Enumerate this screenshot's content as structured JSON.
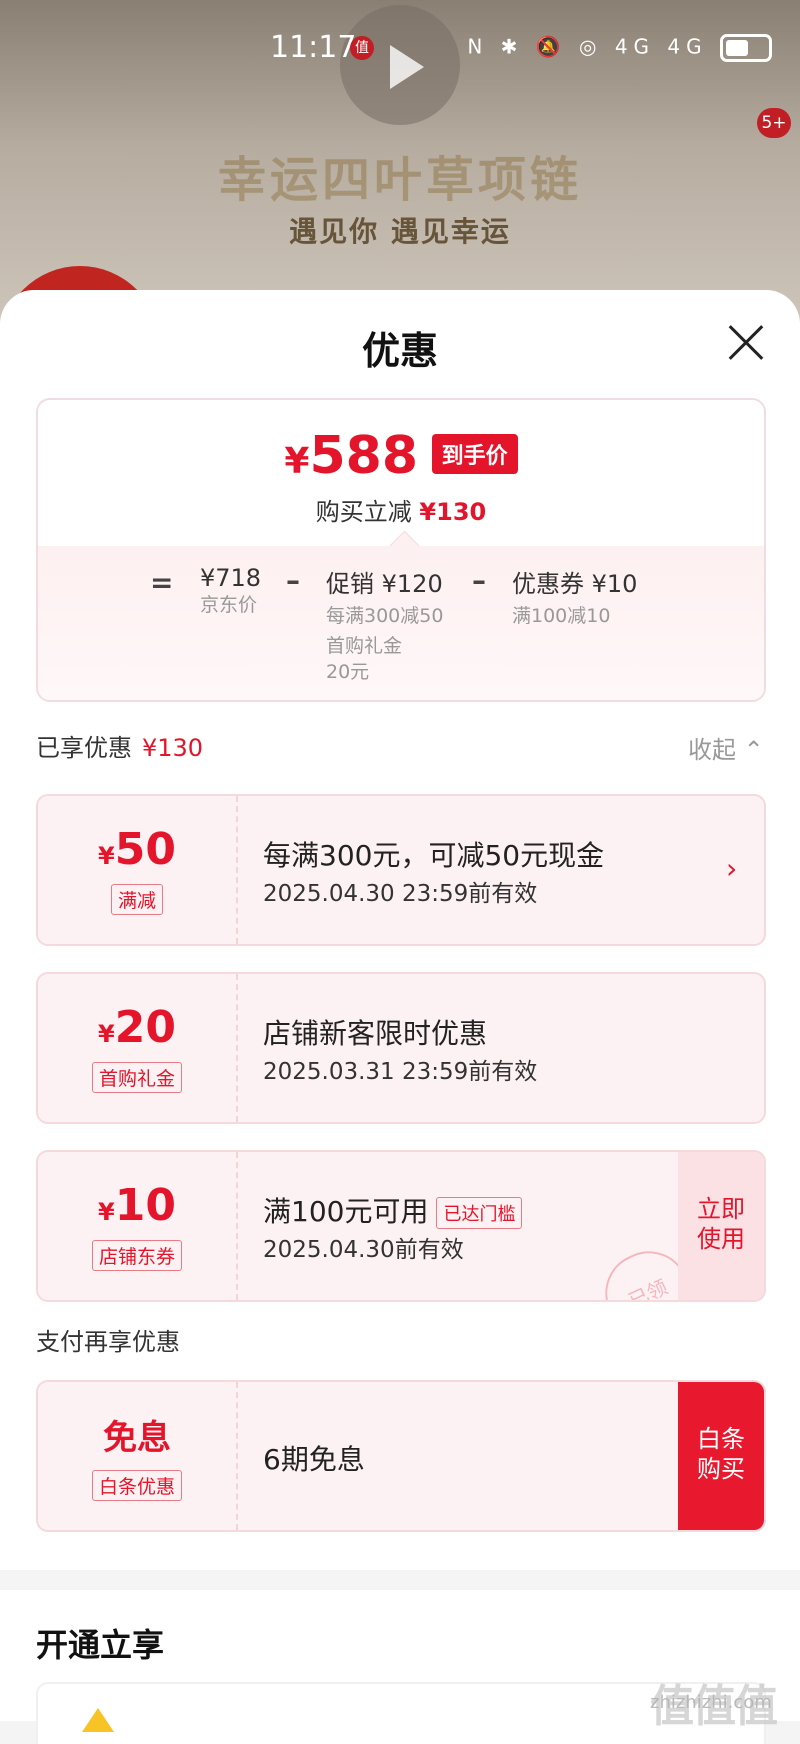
{
  "status_bar": {
    "time": "11:17",
    "app_badge": "值",
    "right_icons": "N ✱ 🔕 ◎ 4G 4G"
  },
  "banner": {
    "title": "幸运四叶草项链",
    "subtitle": "遇见你 遇见幸运",
    "notification_count": "5+"
  },
  "sheet": {
    "title": "优惠"
  },
  "price_summary": {
    "currency": "¥",
    "final_price": "588",
    "final_tag": "到手价",
    "reduce_label": "购买立减",
    "reduce_amount": "¥130",
    "equals": "=",
    "minus": "–",
    "jd_price": "¥718",
    "jd_price_label": "京东价",
    "promo_label": "促销",
    "promo_amount": "¥120",
    "promo_detail_1": "每满300减50",
    "promo_detail_2": "首购礼金",
    "promo_detail_3": "20元",
    "coupon_label": "优惠券",
    "coupon_amount": "¥10",
    "coupon_detail": "满100减10"
  },
  "enjoyed": {
    "label": "已享优惠",
    "amount": "¥130",
    "collapse": "收起 ⌃"
  },
  "coupons": [
    {
      "currency": "¥",
      "amount": "50",
      "tag": "满减",
      "title": "每满300元，可减50元现金",
      "expire": "2025.04.30 23:59前有效",
      "arrow": "›"
    },
    {
      "currency": "¥",
      "amount": "20",
      "tag": "首购礼金",
      "title": "店铺新客限时优惠",
      "expire": "2025.03.31 23:59前有效"
    },
    {
      "currency": "¥",
      "amount": "10",
      "tag": "店铺东券",
      "title": "满100元可用",
      "threshold": "已达门槛",
      "expire": "2025.04.30前有效",
      "button_line1": "立即",
      "button_line2": "使用",
      "stamp": "已领"
    }
  ],
  "pay": {
    "section_title": "支付再享优惠",
    "main": "免息",
    "tag": "白条优惠",
    "title": "6期免息",
    "button_line1": "白条",
    "button_line2": "购买"
  },
  "open": {
    "title": "开通立享"
  },
  "watermark": {
    "logo": "值值值",
    "site": "zhizhizhi.com"
  },
  "colors": {
    "accent": "#e4142b",
    "coupon_bg": "#fdf2f3",
    "button_red": "#e8192e"
  }
}
